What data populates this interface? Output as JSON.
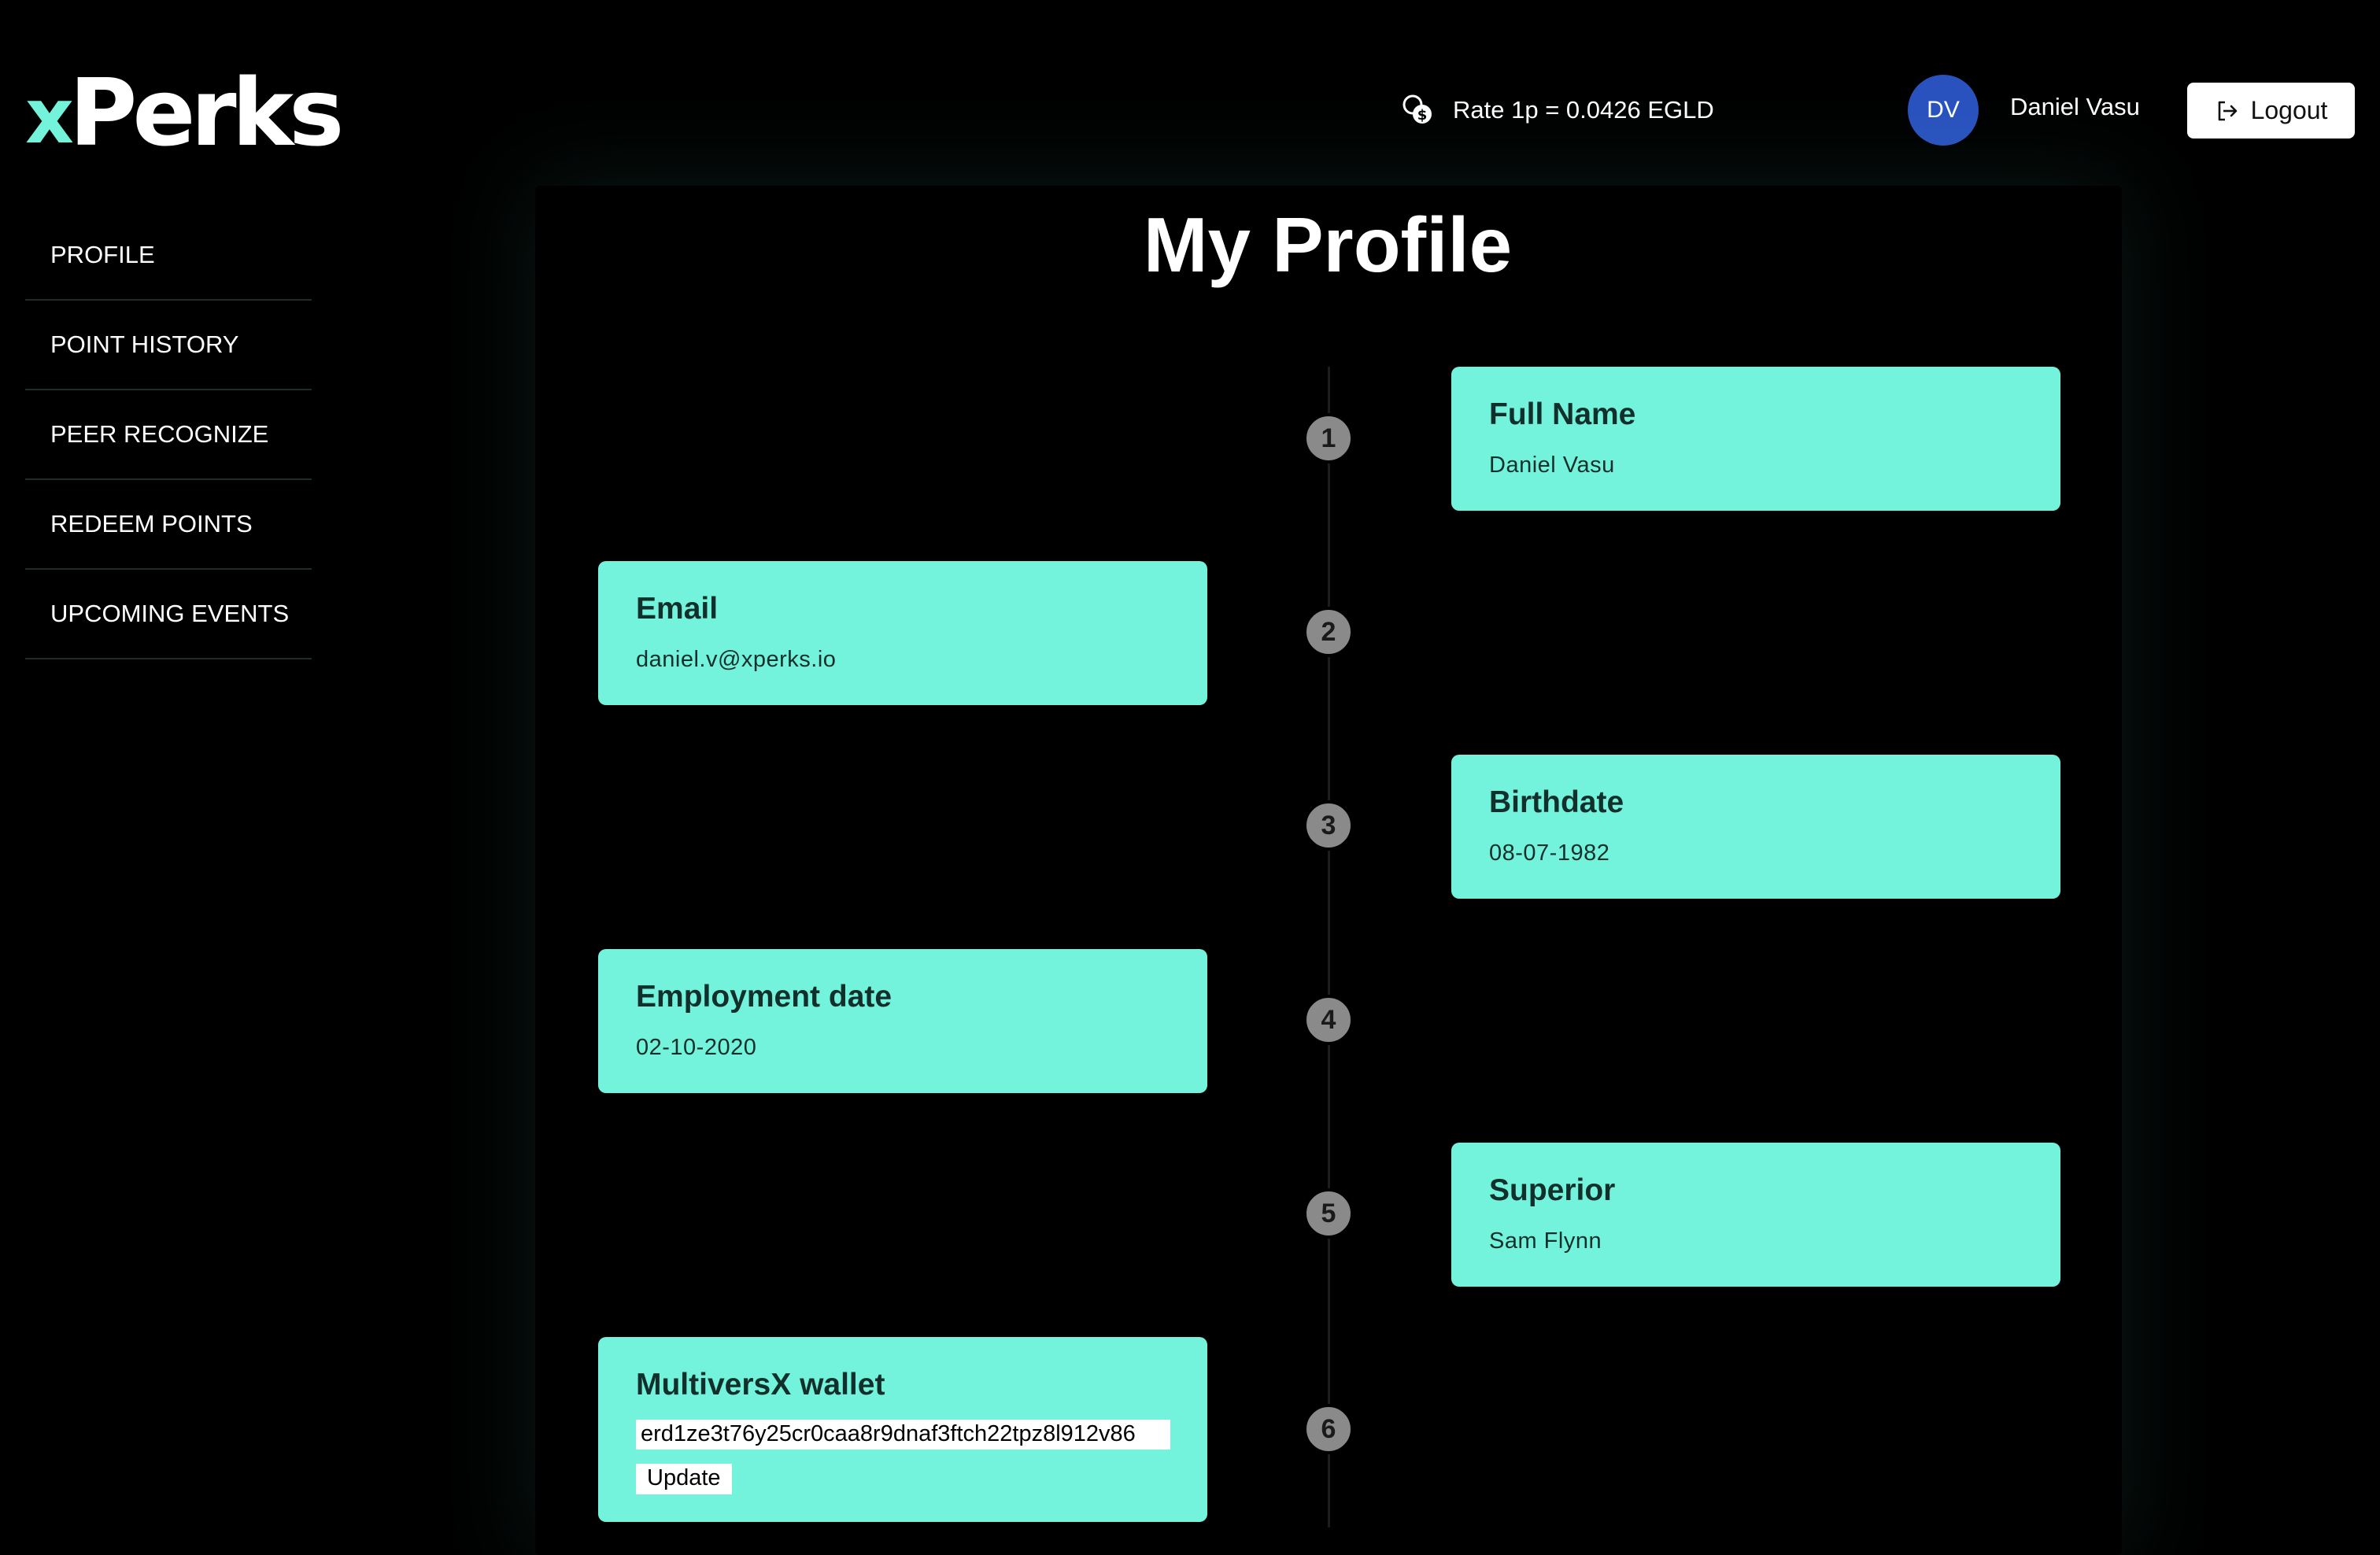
{
  "header": {
    "logo_prefix": "x",
    "logo_word": "Perks",
    "rate_text": "Rate 1p = 0.0426 EGLD",
    "rate_icon": "coins-dollar-icon",
    "avatar_initials": "DV",
    "user_name": "Daniel Vasu",
    "logout_label": "Logout",
    "logout_icon": "logout-arrow-icon"
  },
  "sidebar": {
    "items": [
      {
        "label": "PROFILE"
      },
      {
        "label": "POINT HISTORY"
      },
      {
        "label": "PEER RECOGNIZE"
      },
      {
        "label": "REDEEM POINTS"
      },
      {
        "label": "UPCOMING EVENTS"
      }
    ]
  },
  "main": {
    "title": "My Profile",
    "fields": [
      {
        "step": "1",
        "label": "Full Name",
        "value": "Daniel Vasu"
      },
      {
        "step": "2",
        "label": "Email",
        "value": "daniel.v@xperks.io"
      },
      {
        "step": "3",
        "label": "Birthdate",
        "value": "08-07-1982"
      },
      {
        "step": "4",
        "label": "Employment date",
        "value": "02-10-2020"
      },
      {
        "step": "5",
        "label": "Superior",
        "value": "Sam Flynn"
      },
      {
        "step": "6",
        "label": "MultiversX wallet",
        "value": "erd1ze3t76y25cr0caa8r9dnaf3ftch22tpz8l912v86",
        "button": "Update"
      }
    ]
  },
  "colors": {
    "background": "#000000",
    "accent": "#74f3dc",
    "avatar": "#2a52be",
    "step_badge": "#8a8a8a"
  }
}
